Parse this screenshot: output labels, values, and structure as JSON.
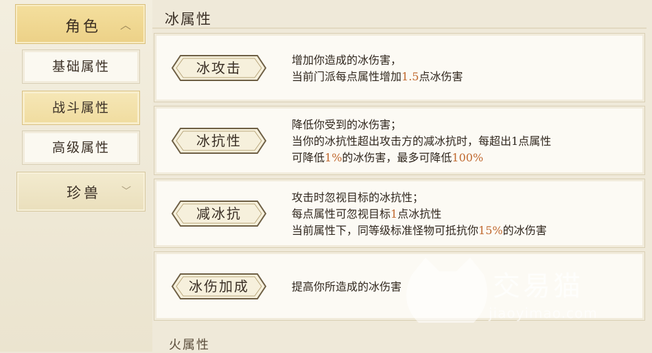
{
  "sidebar": {
    "category_label": "角色",
    "items": [
      {
        "label": "基础属性",
        "active": false
      },
      {
        "label": "战斗属性",
        "active": true
      },
      {
        "label": "高级属性",
        "active": false
      }
    ],
    "treasure_label": "珍兽"
  },
  "main": {
    "section_title": "冰属性",
    "cards": [
      {
        "badge": "冰攻击",
        "lines": [
          [
            "增加你造成的冰伤害，"
          ],
          [
            "当前门派每点属性增加",
            {
              "hl": "1.5"
            },
            "点冰伤害"
          ]
        ]
      },
      {
        "badge": "冰抗性",
        "lines": [
          [
            "降低你受到的冰伤害；"
          ],
          [
            "当你的冰抗性超出攻击方的减冰抗时，每超出1点属性"
          ],
          [
            "可降低",
            {
              "hl": "1%"
            },
            "的冰伤害，最多可降低",
            {
              "hl": "100%"
            }
          ]
        ]
      },
      {
        "badge": "减冰抗",
        "lines": [
          [
            "攻击时忽视目标的冰抗性；"
          ],
          [
            "每点属性可忽视目标",
            {
              "hl": "1"
            },
            "点冰抗性"
          ],
          [
            "当前属性下，同等级标准怪物可抵抗你",
            {
              "hl": "15%"
            },
            "的冰伤害"
          ]
        ]
      },
      {
        "badge": "冰伤加成",
        "lines": [
          [
            "提高你所造成的冰伤害"
          ]
        ]
      }
    ],
    "next_section_peek": "火属性"
  },
  "watermark": {
    "text": "交易猫",
    "url": "jiaoyimao.com"
  },
  "colors": {
    "highlight": "#c0692f",
    "active_tab": "#f0dc9f",
    "card_bg": "#fcfaf4"
  },
  "icons": {
    "category_chevron": "chevron-up-icon",
    "treasure_chevron": "chevron-down-icon"
  }
}
